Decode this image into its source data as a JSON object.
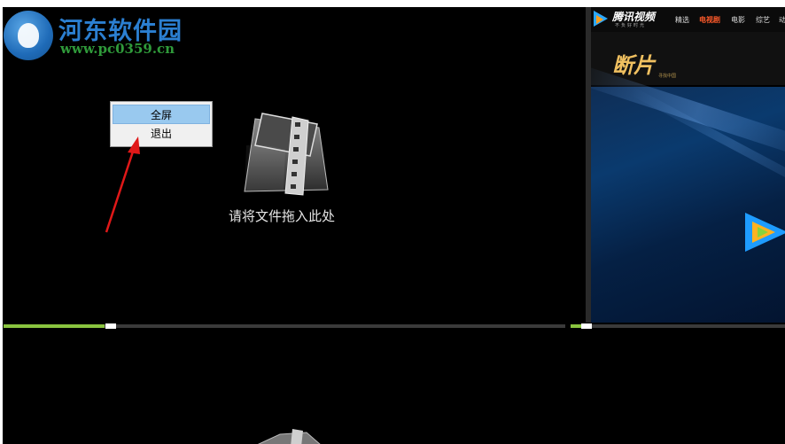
{
  "watermark": {
    "title": "河东软件园",
    "url": "www.pc0359.cn"
  },
  "context_menu": {
    "items": [
      {
        "label": "全屏",
        "selected": true
      },
      {
        "label": "退出",
        "selected": false
      }
    ]
  },
  "player": {
    "drop_hint": "请将文件拖入此处",
    "progress_left": 0.18,
    "progress_right": 0.05
  },
  "embedded_site": {
    "brand": "腾讯视频",
    "slogan": "不负好时光",
    "tabs": [
      "精选",
      "电视剧",
      "电影",
      "综艺",
      "动"
    ],
    "active_tab": "电视剧",
    "banner_title": "断片",
    "banner_subtitle": "寻找中国"
  },
  "colors": {
    "accent_green": "#8ac43f",
    "watermark_blue": "#2b7fd1",
    "watermark_green": "#2f9a3a",
    "menu_highlight": "#99c9ef",
    "arrow_red": "#e01818",
    "active_tab": "#ff5a2a"
  }
}
